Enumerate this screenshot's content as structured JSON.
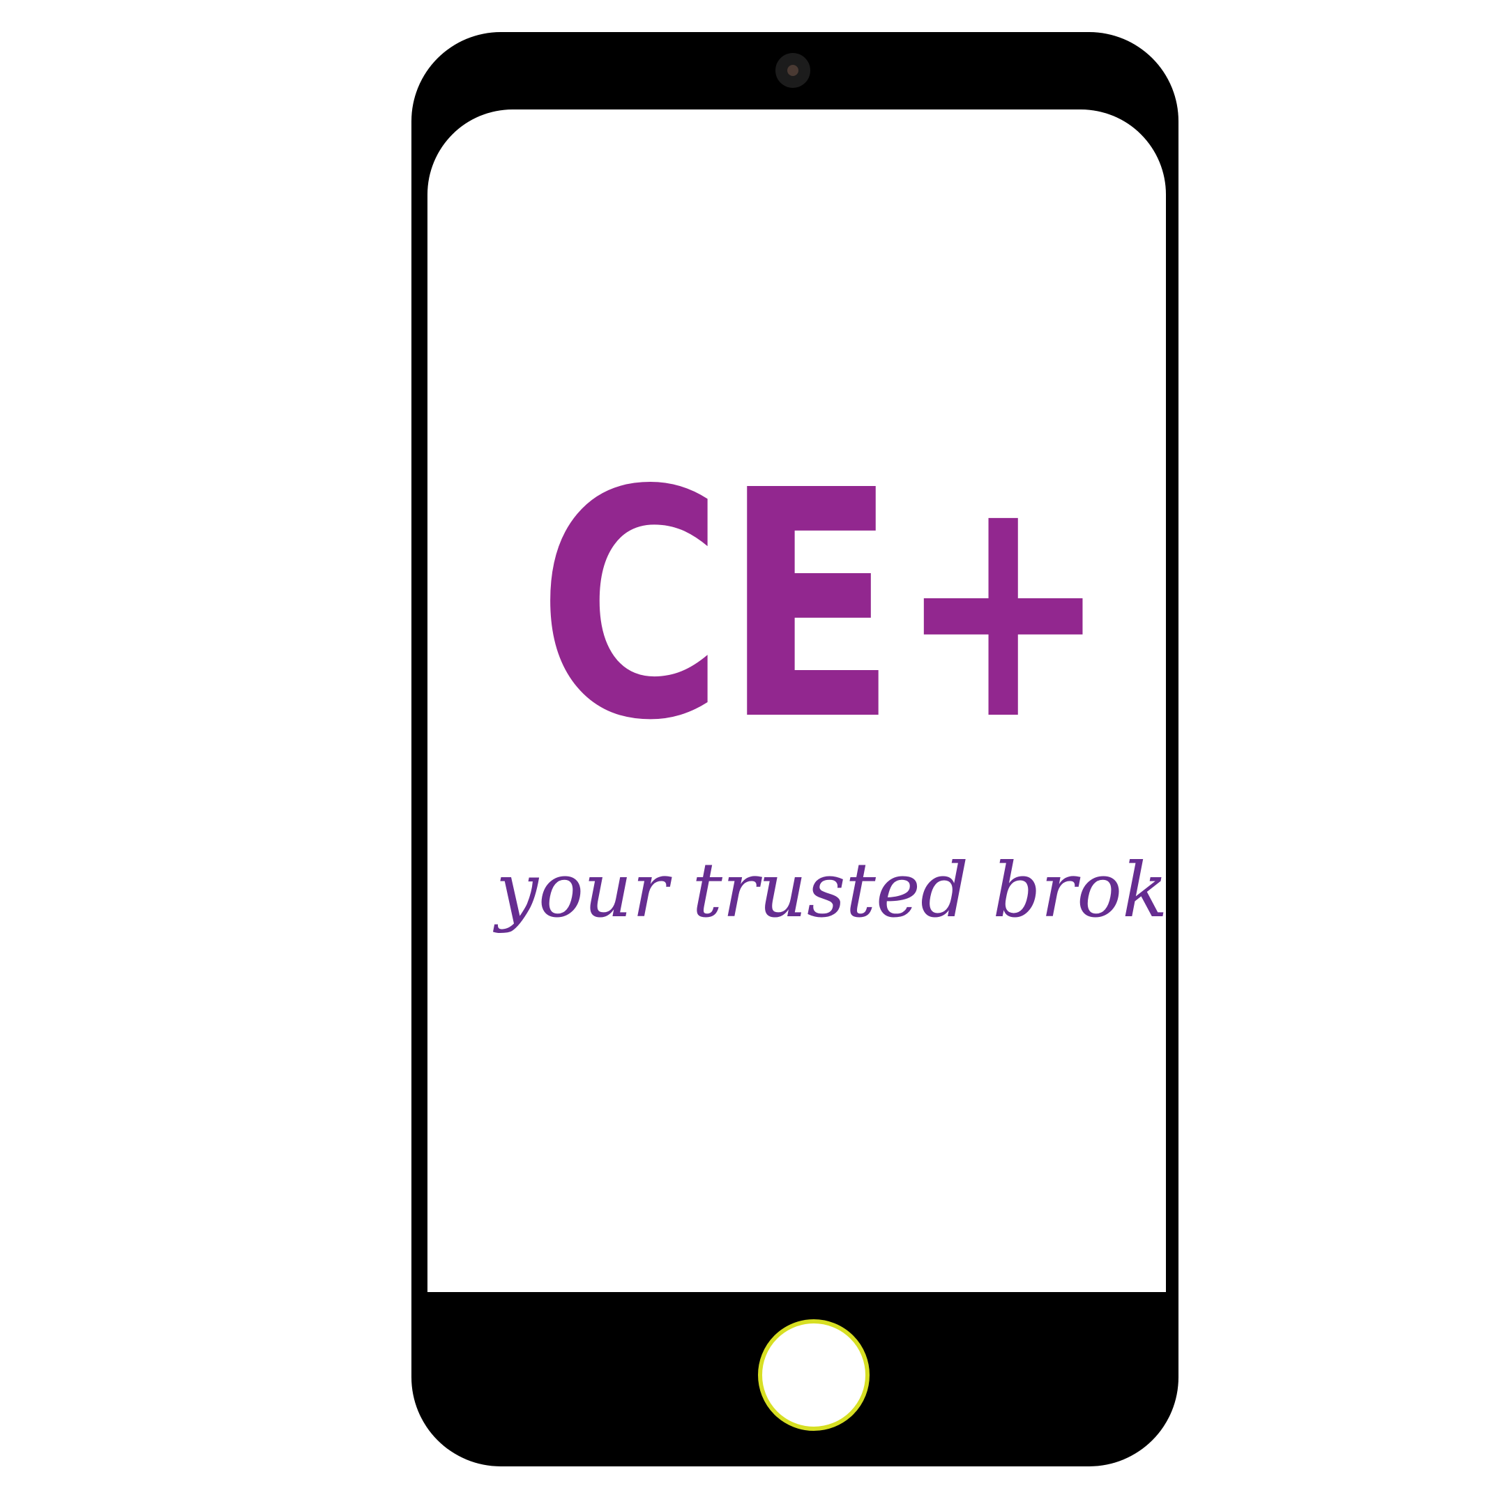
{
  "device": {
    "type": "smartphone",
    "frame_color": "#000000",
    "screen_color": "#ffffff",
    "home_button_ring_color": "#d7df23"
  },
  "screen": {
    "logo": {
      "text": "CE+",
      "color": "#92278f"
    },
    "tagline": {
      "text": "your trusted broker!",
      "color": "#662d91"
    }
  },
  "icons": {
    "camera": "camera-icon",
    "home": "home-button-icon"
  }
}
